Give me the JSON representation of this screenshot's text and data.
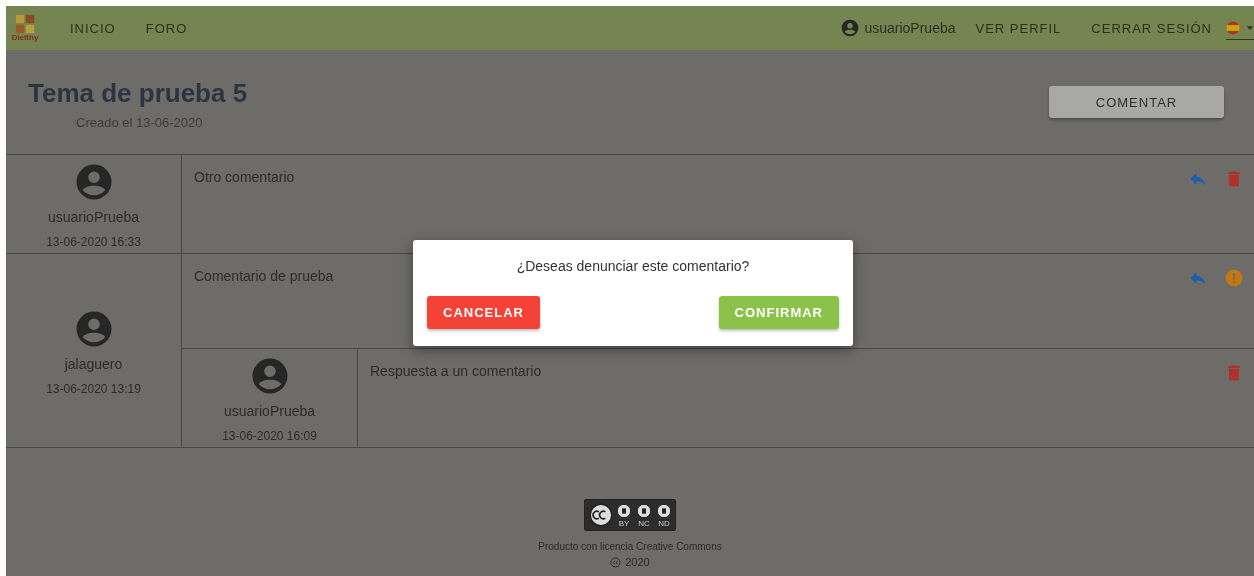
{
  "navbar": {
    "logo_text": "Dielthy",
    "links": [
      {
        "label": "INICIO"
      },
      {
        "label": "FORO"
      }
    ],
    "user": "usuarioPrueba",
    "actions": [
      {
        "label": "VER PERFIL"
      },
      {
        "label": "CERRAR SESIÓN"
      }
    ]
  },
  "topic": {
    "title": "Tema de prueba 5",
    "created": "Creado el 13-06-2020",
    "button": "COMENTAR"
  },
  "comments": [
    {
      "author": "usuarioPrueba",
      "date": "13-06-2020 16:33",
      "text": "Otro comentario",
      "actions": [
        {
          "kind": "reply"
        },
        {
          "kind": "delete"
        }
      ]
    },
    {
      "author": "jalaguero",
      "date": "13-06-2020 13:19",
      "text": "Comentario de prueba",
      "actions": [
        {
          "kind": "reply"
        },
        {
          "kind": "report"
        }
      ],
      "children": [
        {
          "author": "usuarioPrueba",
          "date": "13-06-2020 16:09",
          "text": "Respuesta a un comentario",
          "actions": [
            {
              "kind": "delete"
            }
          ]
        }
      ]
    }
  ],
  "dialog": {
    "message": "¿Deseas denunciar este comentario?",
    "buttons": [
      {
        "kind": "cancel",
        "label": "CANCELAR"
      },
      {
        "kind": "confirm",
        "label": "CONFIRMAR"
      }
    ]
  },
  "footer": {
    "badge_labels": [
      "BY",
      "NC",
      "ND"
    ],
    "license": "Producto con licencia Creative Commons",
    "year": "2020"
  }
}
